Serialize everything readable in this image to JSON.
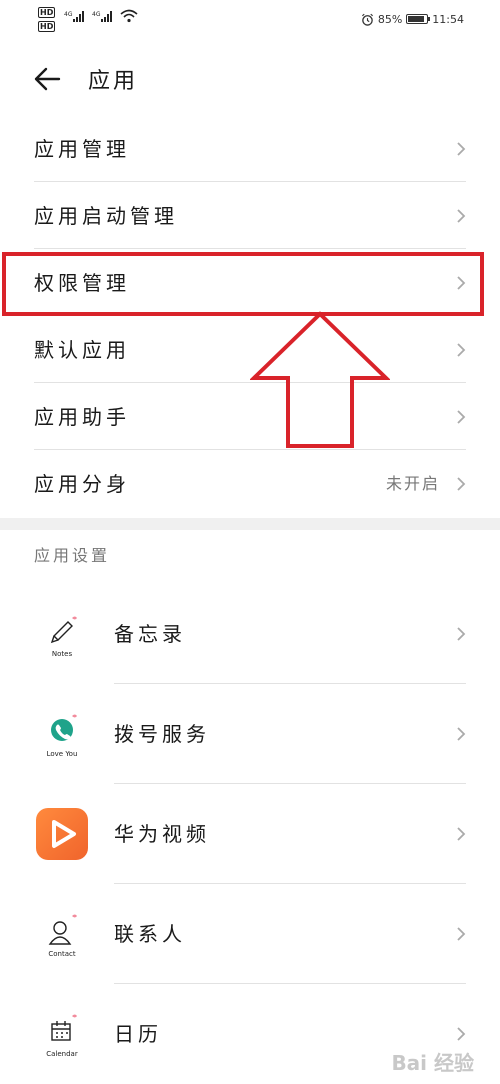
{
  "status_bar": {
    "network_badge_1": "HD",
    "network_badge_2": "HD",
    "signal_1": "4G",
    "signal_2": "4G",
    "battery_percent": "85%",
    "battery_level": 0.85,
    "time": "11:54"
  },
  "header": {
    "title": "应用"
  },
  "menu": [
    {
      "label": "应用管理"
    },
    {
      "label": "应用启动管理"
    },
    {
      "label": "权限管理"
    },
    {
      "label": "默认应用"
    },
    {
      "label": "应用助手"
    },
    {
      "label": "应用分身",
      "value": "未开启"
    }
  ],
  "section": {
    "title": "应用设置"
  },
  "apps": [
    {
      "label": "备忘录",
      "icon": "notes-icon",
      "icon_text": "Notes"
    },
    {
      "label": "拨号服务",
      "icon": "phone-icon",
      "icon_text": "Love You"
    },
    {
      "label": "华为视频",
      "icon": "video-play-icon"
    },
    {
      "label": "联系人",
      "icon": "contact-icon",
      "icon_text": "Contact"
    },
    {
      "label": "日历",
      "icon": "calendar-icon",
      "icon_text": "Calendar"
    }
  ],
  "annotation": {
    "highlight_color": "#d9232a"
  },
  "watermark": "Bai 经验"
}
